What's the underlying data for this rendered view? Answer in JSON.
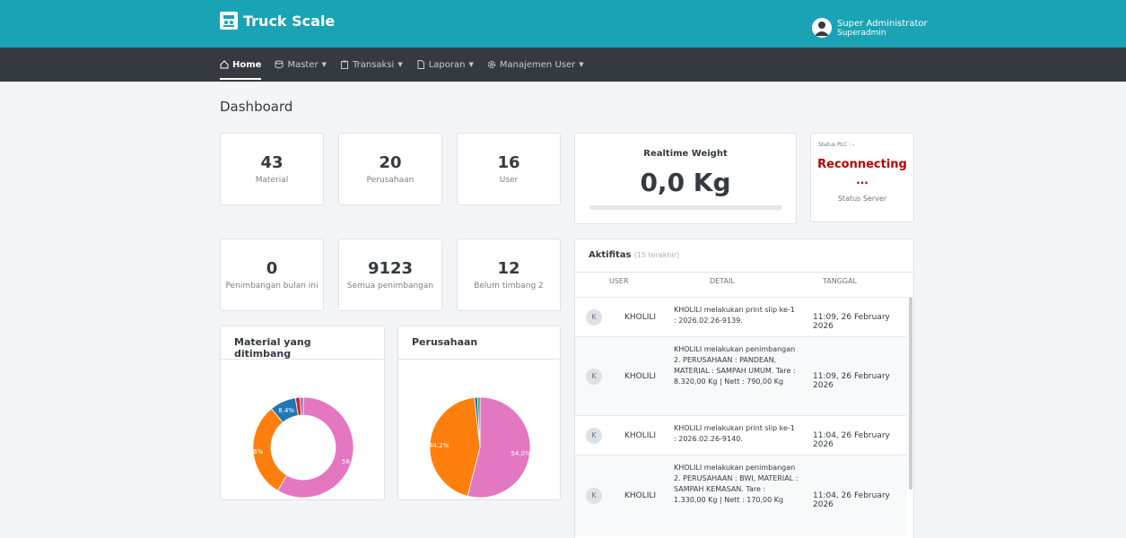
{
  "header": {
    "brand": "Truck Scale",
    "user_name": "Super Administrator",
    "user_role": "Superadmin",
    "brand_color": "#1aa3b4"
  },
  "nav": [
    {
      "label": "Home",
      "icon": "home-icon",
      "dropdown": false,
      "active": true
    },
    {
      "label": "Master",
      "icon": "database-icon",
      "dropdown": true,
      "active": false
    },
    {
      "label": "Transaksi",
      "icon": "clipboard-icon",
      "dropdown": true,
      "active": false
    },
    {
      "label": "Laporan",
      "icon": "file-icon",
      "dropdown": true,
      "active": false
    },
    {
      "label": "Manajemen User",
      "icon": "gear-icon",
      "dropdown": true,
      "active": false
    }
  ],
  "page_title": "Dashboard",
  "stats": [
    {
      "value": "43",
      "label": "Material"
    },
    {
      "value": "20",
      "label": "Perusahaan"
    },
    {
      "value": "16",
      "label": "User"
    },
    {
      "value": "0",
      "label": "Penimbangan bulan ini"
    },
    {
      "value": "9123",
      "label": "Semua penimbangan"
    },
    {
      "value": "12",
      "label": "Belum timbang 2"
    }
  ],
  "realtime": {
    "title": "Realtime Weight",
    "value": "0,0 Kg",
    "progress": 0
  },
  "plc": {
    "label": "Status PLC : -",
    "status": "Reconnecting",
    "dots": "...",
    "server_label": "Status Server",
    "status_color": "#bb0000"
  },
  "charts": {
    "material": {
      "title": "Material yang ditimbang",
      "type": "donut",
      "slices": [
        {
          "value": 58.5,
          "label": "58.5%",
          "color": "#e377c2"
        },
        {
          "value": 30.6,
          "label": "30.6%",
          "color": "#ff7f0e"
        },
        {
          "value": 8.4,
          "label": "8.4%",
          "color": "#1f77b4"
        },
        {
          "value": 1.5,
          "label": "",
          "color": "#d62728"
        },
        {
          "value": 1.0,
          "label": "",
          "color": "#9467bd"
        }
      ]
    },
    "perusahaan": {
      "title": "Perusahaan",
      "type": "pie",
      "slices": [
        {
          "value": 54.0,
          "label": "54.0%",
          "color": "#e377c2"
        },
        {
          "value": 44.2,
          "label": "44.2%",
          "color": "#ff7f0e"
        },
        {
          "value": 1.0,
          "label": "",
          "color": "#1f77b4"
        },
        {
          "value": 0.8,
          "label": "",
          "color": "#2ca02c"
        }
      ]
    }
  },
  "activity": {
    "title": "Aktifitas",
    "subtitle": "(15 terakhir)",
    "columns": {
      "user": "USER",
      "detail": "DETAIL",
      "date": "TANGGAL"
    },
    "rows": [
      {
        "initial": "K",
        "user": "KHOLILI",
        "detail": "KHOLILI melakukan print slip ke-1 : 2026.02.26-9139.",
        "date": "11:09, 26 February 2026"
      },
      {
        "initial": "K",
        "user": "KHOLILI",
        "detail": "KHOLILI melakukan penimbangan 2. PERUSAHAAN : PANDEAN, MATERIAL : SAMPAH UMUM. Tare : 8.320,00 Kg | Nett : 790,00 Kg",
        "date": "11:09, 26 February 2026"
      },
      {
        "initial": "K",
        "user": "KHOLILI",
        "detail": "KHOLILI melakukan print slip ke-1 : 2026.02.26-9140.",
        "date": "11:04, 26 February 2026"
      },
      {
        "initial": "K",
        "user": "KHOLILI",
        "detail": "KHOLILI melakukan penimbangan 2. PERUSAHAAN : BWI, MATERIAL : SAMPAH KEMASAN. Tare : 1.330,00 Kg | Nett : 170,00 Kg",
        "date": "11:04, 26 February 2026"
      }
    ]
  }
}
